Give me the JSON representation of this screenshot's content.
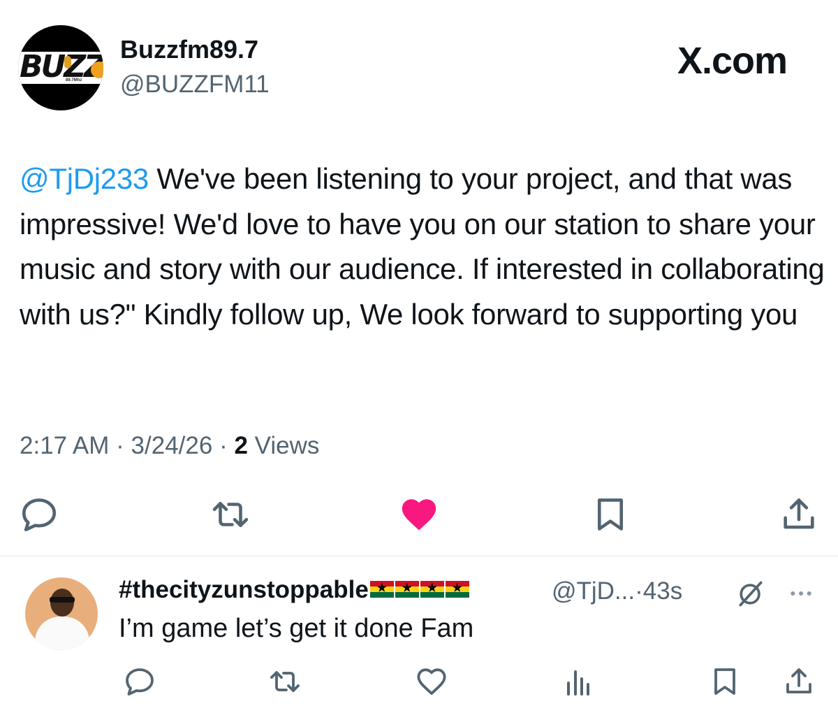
{
  "tweet": {
    "avatar": {
      "logo_text": "BUZZ",
      "freq_text": "89.7Mhz"
    },
    "display_name": "Buzzfm89.7",
    "handle": "@BUZZFM11",
    "brand": "X.com",
    "mention": "@TjDj233",
    "text": " We've been listening to your project, and that was impressive! We'd love to have you on our station to share your music and story with our audience. If interested in collaborating with us?\" Kindly follow up, We look forward to supporting you",
    "time": "2:17 AM",
    "date": "3/24/26",
    "views_count": "2",
    "views_label": "Views",
    "separator": "·",
    "actions": [
      {
        "name": "reply",
        "icon": "reply-icon"
      },
      {
        "name": "retweet",
        "icon": "retweet-icon"
      },
      {
        "name": "like",
        "icon": "heart-filled-icon",
        "color": "#f91880",
        "liked": true
      },
      {
        "name": "bookmark",
        "icon": "bookmark-icon"
      },
      {
        "name": "share",
        "icon": "share-icon"
      }
    ]
  },
  "reply": {
    "display_name": "#thecityzunstoppable",
    "flags": [
      "ghana-flag",
      "ghana-flag",
      "ghana-flag",
      "ghana-flag"
    ],
    "handle": "@TjD...",
    "time": "43s",
    "separator": "·",
    "text": "I’m game let’s get it done Fam",
    "actions": [
      {
        "name": "reply",
        "icon": "reply-icon"
      },
      {
        "name": "retweet",
        "icon": "retweet-icon"
      },
      {
        "name": "like",
        "icon": "heart-outline-icon"
      },
      {
        "name": "views",
        "icon": "analytics-icon"
      },
      {
        "name": "bookmark",
        "icon": "bookmark-icon"
      },
      {
        "name": "share",
        "icon": "share-icon"
      }
    ]
  },
  "colors": {
    "text": "#0f1419",
    "secondary": "#536471",
    "link": "#1d9bf0",
    "like": "#f91880",
    "divider": "#e1e6ea"
  }
}
